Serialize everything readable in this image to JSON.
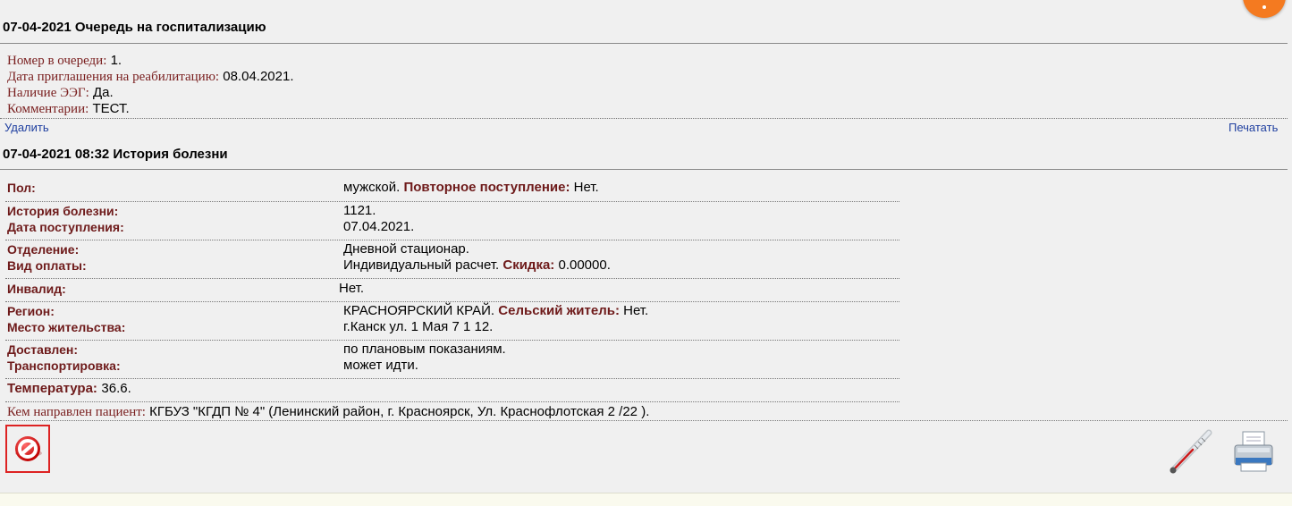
{
  "queue": {
    "title": "07-04-2021 Очередь на госпитализацию",
    "fields": [
      {
        "label": "Номер в очереди:",
        "value": "1."
      },
      {
        "label": "Дата приглашения на реабилитацию:",
        "value": "08.04.2021."
      },
      {
        "label": "Наличие ЭЭГ:",
        "value": "Да."
      },
      {
        "label": "Комментарии:",
        "value": "ТЕСТ."
      }
    ],
    "delete_label": "Удалить",
    "print_label": "Печатать"
  },
  "history": {
    "title": "07-04-2021 08:32 История болезни",
    "sex_label": "Пол:",
    "sex_value": "мужской.",
    "repeat_label": "Повторное поступление:",
    "repeat_value": "Нет.",
    "case_label": "История болезни:",
    "case_value": "1121.",
    "admission_label": "Дата поступления:",
    "admission_value": "07.04.2021.",
    "dept_label": "Отделение:",
    "dept_value": "Дневной стационар.",
    "payment_label": "Вид оплаты:",
    "payment_value": "Индивидуальный расчет.",
    "discount_label": "Скидка:",
    "discount_value": "0.00000.",
    "disabled_label": "Инвалид:",
    "disabled_value": "Нет.",
    "region_label": "Регион:",
    "region_value": "КРАСНОЯРСКИЙ КРАЙ.",
    "rural_label": "Сельский житель:",
    "rural_value": "Нет.",
    "residence_label": "Место жительства:",
    "residence_value": "г.Канск ул. 1 Мая 7 1 12.",
    "delivered_label": "Доставлен:",
    "delivered_value": "по плановым показаниям.",
    "transport_label": "Транспортировка:",
    "transport_value": "может идти.",
    "temp_label": "Температура:",
    "temp_value": "36.6.",
    "referred_label": "Кем направлен пациент:",
    "referred_value": "КГБУЗ \"КГДП № 4\" (Ленинский район, г. Красноярск, Ул. Краснофлотская 2 /22 )."
  },
  "icons": {
    "fab": "orange-action-button",
    "delete": "no-entry-icon",
    "thermometer": "thermometer-icon",
    "print": "printer-icon"
  },
  "colors": {
    "label": "#6e1a1a",
    "link": "#2040a0",
    "fab": "#f47a20",
    "delete_border": "#d22222"
  }
}
